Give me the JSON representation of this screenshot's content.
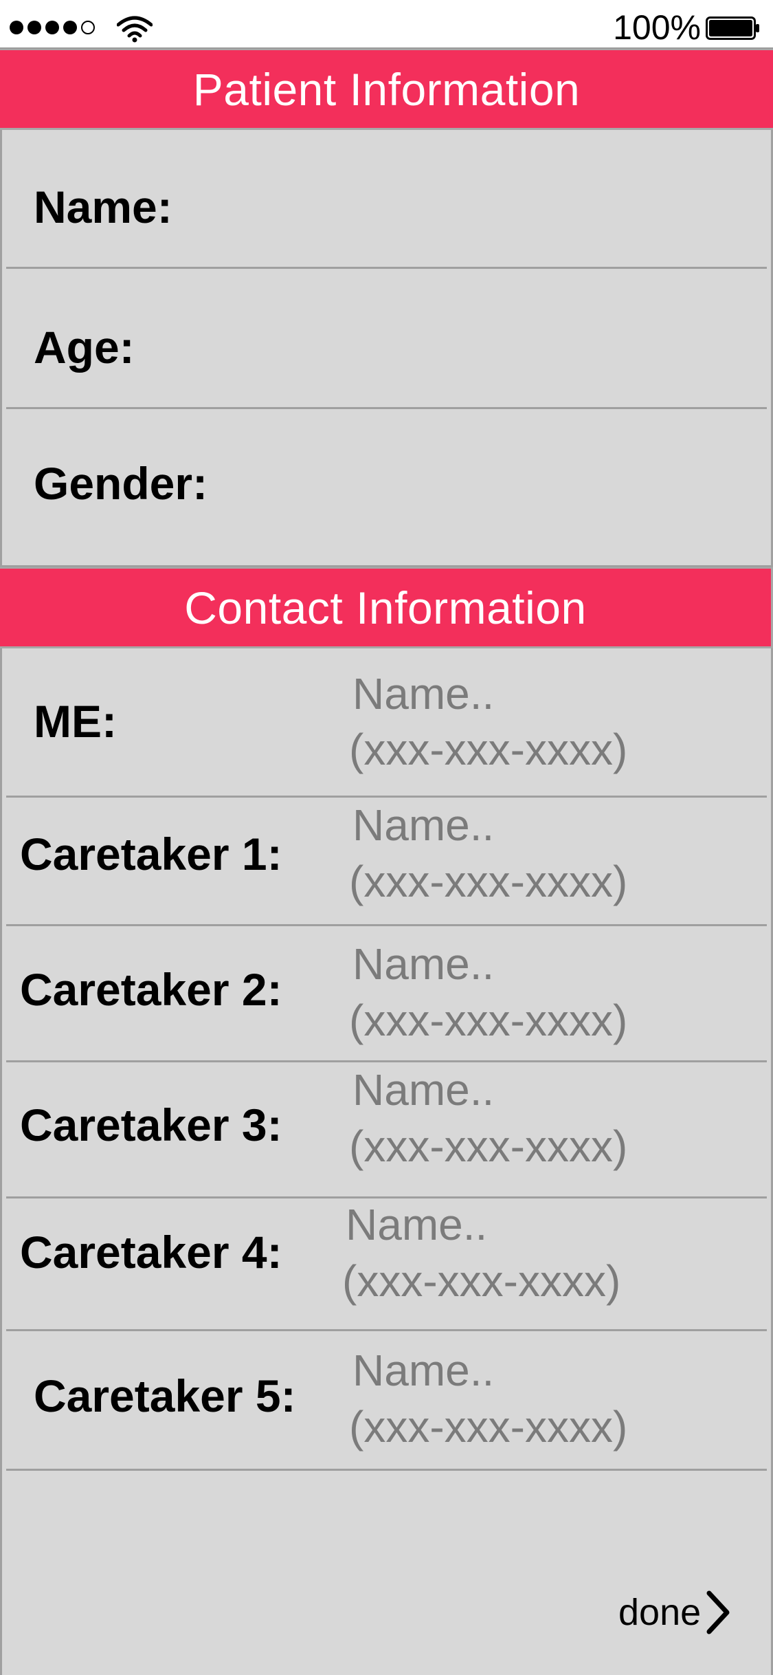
{
  "status_bar": {
    "signal_bars_filled": 4,
    "signal_bars_total": 5,
    "wifi_icon": "wifi-icon",
    "battery_text": "100%",
    "battery_icon": "battery-full-icon",
    "battery_level": 1.0
  },
  "patient_section": {
    "title": "Patient Information",
    "fields": {
      "name_label": "Name:",
      "age_label": "Age:",
      "gender_label": "Gender:"
    }
  },
  "contact_section": {
    "title": "Contact Information",
    "contacts": [
      {
        "label": "ME:",
        "name_placeholder": "Name..",
        "phone_placeholder": "(xxx-xxx-xxxx)"
      },
      {
        "label": "Caretaker 1:",
        "name_placeholder": "Name..",
        "phone_placeholder": "(xxx-xxx-xxxx)"
      },
      {
        "label": "Caretaker 2:",
        "name_placeholder": "Name..",
        "phone_placeholder": "(xxx-xxx-xxxx)"
      },
      {
        "label": "Caretaker 3:",
        "name_placeholder": "Name..",
        "phone_placeholder": "(xxx-xxx-xxxx)"
      },
      {
        "label": "Caretaker 4:",
        "name_placeholder": "Name..",
        "phone_placeholder": "(xxx-xxx-xxxx)"
      },
      {
        "label": "Caretaker 5:",
        "name_placeholder": "Name..",
        "phone_placeholder": "(xxx-xxx-xxxx)"
      }
    ]
  },
  "footer": {
    "done_label": "done",
    "done_icon": "chevron-right-icon"
  },
  "colors": {
    "header_background": "#f32f5b",
    "header_text": "#ffffff",
    "page_background": "#d8d8d8",
    "placeholder_text": "#7b7b7b"
  }
}
